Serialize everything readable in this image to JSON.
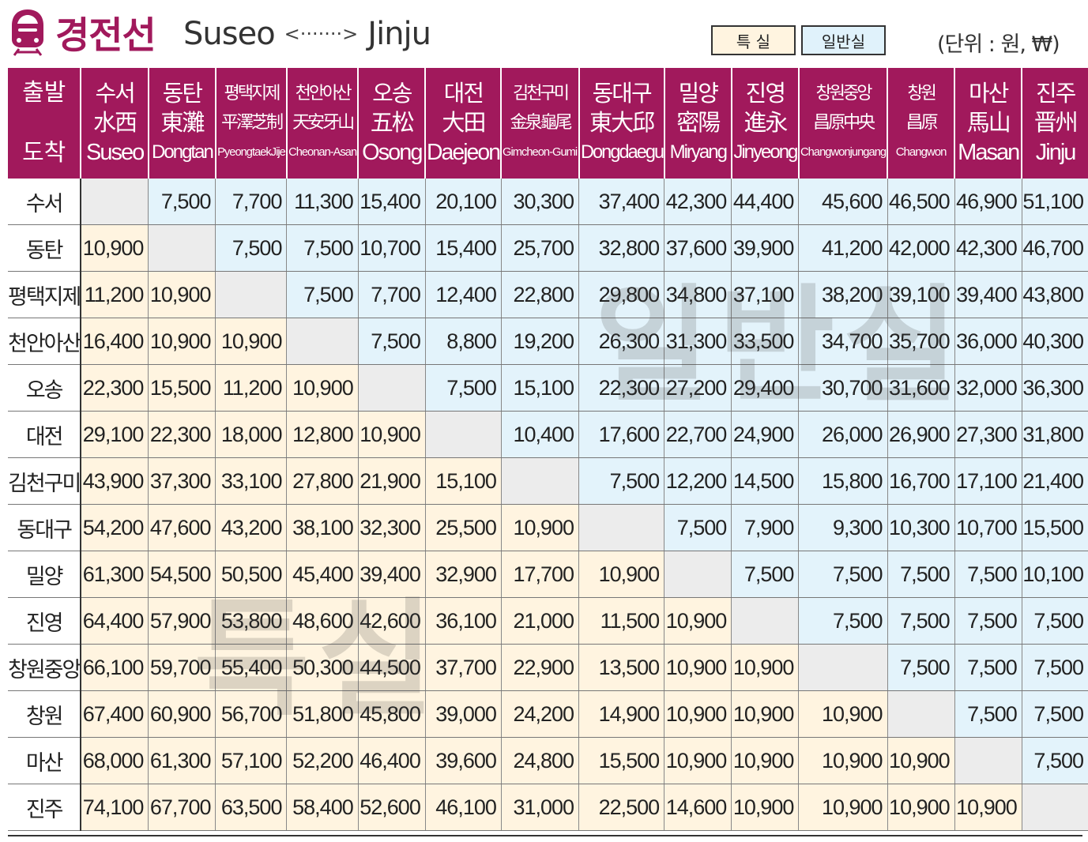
{
  "header": {
    "line_name": "경전선",
    "origin": "Suseo",
    "arrow": "<·······>",
    "destination": "Jinju",
    "legend_first": "특 실",
    "legend_general": "일반실",
    "unit": "(단위 : 원, ₩)",
    "train_icon": "train-icon"
  },
  "table": {
    "corner_top": "출발",
    "corner_bottom": "도착",
    "stations": [
      {
        "kr": "수서",
        "hanja": "水西",
        "en": "Suseo"
      },
      {
        "kr": "동탄",
        "hanja": "東灘",
        "en": "Dongtan"
      },
      {
        "kr": "평택지제",
        "hanja": "平澤芝制",
        "en": "PyeongtaekJije"
      },
      {
        "kr": "천안아산",
        "hanja": "天安牙山",
        "en": "Cheonan-Asan"
      },
      {
        "kr": "오송",
        "hanja": "五松",
        "en": "Osong"
      },
      {
        "kr": "대전",
        "hanja": "大田",
        "en": "Daejeon"
      },
      {
        "kr": "김천구미",
        "hanja": "金泉龜尾",
        "en": "Gimcheon-Gumi"
      },
      {
        "kr": "동대구",
        "hanja": "東大邱",
        "en": "Dongdaegu"
      },
      {
        "kr": "밀양",
        "hanja": "密陽",
        "en": "Miryang"
      },
      {
        "kr": "진영",
        "hanja": "進永",
        "en": "Jinyeong"
      },
      {
        "kr": "창원중앙",
        "hanja": "昌原中央",
        "en": "Changwonjungang"
      },
      {
        "kr": "창원",
        "hanja": "昌原",
        "en": "Changwon"
      },
      {
        "kr": "마산",
        "hanja": "馬山",
        "en": "Masan"
      },
      {
        "kr": "진주",
        "hanja": "晋州",
        "en": "Jinju"
      }
    ],
    "rows": [
      [
        "",
        "7,500",
        "7,700",
        "11,300",
        "15,400",
        "20,100",
        "30,300",
        "37,400",
        "42,300",
        "44,400",
        "45,600",
        "46,500",
        "46,900",
        "51,100"
      ],
      [
        "10,900",
        "",
        "7,500",
        "7,500",
        "10,700",
        "15,400",
        "25,700",
        "32,800",
        "37,600",
        "39,900",
        "41,200",
        "42,000",
        "42,300",
        "46,700"
      ],
      [
        "11,200",
        "10,900",
        "",
        "7,500",
        "7,700",
        "12,400",
        "22,800",
        "29,800",
        "34,800",
        "37,100",
        "38,200",
        "39,100",
        "39,400",
        "43,800"
      ],
      [
        "16,400",
        "10,900",
        "10,900",
        "",
        "7,500",
        "8,800",
        "19,200",
        "26,300",
        "31,300",
        "33,500",
        "34,700",
        "35,700",
        "36,000",
        "40,300"
      ],
      [
        "22,300",
        "15,500",
        "11,200",
        "10,900",
        "",
        "7,500",
        "15,100",
        "22,300",
        "27,200",
        "29,400",
        "30,700",
        "31,600",
        "32,000",
        "36,300"
      ],
      [
        "29,100",
        "22,300",
        "18,000",
        "12,800",
        "10,900",
        "",
        "10,400",
        "17,600",
        "22,700",
        "24,900",
        "26,000",
        "26,900",
        "27,300",
        "31,800"
      ],
      [
        "43,900",
        "37,300",
        "33,100",
        "27,800",
        "21,900",
        "15,100",
        "",
        "7,500",
        "12,200",
        "14,500",
        "15,800",
        "16,700",
        "17,100",
        "21,400"
      ],
      [
        "54,200",
        "47,600",
        "43,200",
        "38,100",
        "32,300",
        "25,500",
        "10,900",
        "",
        "7,500",
        "7,900",
        "9,300",
        "10,300",
        "10,700",
        "15,500"
      ],
      [
        "61,300",
        "54,500",
        "50,500",
        "45,400",
        "39,400",
        "32,900",
        "17,700",
        "10,900",
        "",
        "7,500",
        "7,500",
        "7,500",
        "7,500",
        "10,100"
      ],
      [
        "64,400",
        "57,900",
        "53,800",
        "48,600",
        "42,600",
        "36,100",
        "21,000",
        "11,500",
        "10,900",
        "",
        "7,500",
        "7,500",
        "7,500",
        "7,500"
      ],
      [
        "66,100",
        "59,700",
        "55,400",
        "50,300",
        "44,500",
        "37,700",
        "22,900",
        "13,500",
        "10,900",
        "10,900",
        "",
        "7,500",
        "7,500",
        "7,500"
      ],
      [
        "67,400",
        "60,900",
        "56,700",
        "51,800",
        "45,800",
        "39,000",
        "24,200",
        "14,900",
        "10,900",
        "10,900",
        "10,900",
        "",
        "7,500",
        "7,500"
      ],
      [
        "68,000",
        "61,300",
        "57,100",
        "52,200",
        "46,400",
        "39,600",
        "24,800",
        "15,500",
        "10,900",
        "10,900",
        "10,900",
        "10,900",
        "",
        "7,500"
      ],
      [
        "74,100",
        "67,700",
        "63,500",
        "58,400",
        "52,600",
        "46,100",
        "31,000",
        "22,500",
        "14,600",
        "10,900",
        "10,900",
        "10,900",
        "10,900",
        ""
      ]
    ]
  },
  "watermarks": {
    "general": "일반실",
    "first": "특실"
  },
  "colors": {
    "brand": "#a1195c",
    "first_class_bg": "#fff4e0",
    "general_class_bg": "#e3f3fb",
    "empty_bg": "#ececec"
  }
}
